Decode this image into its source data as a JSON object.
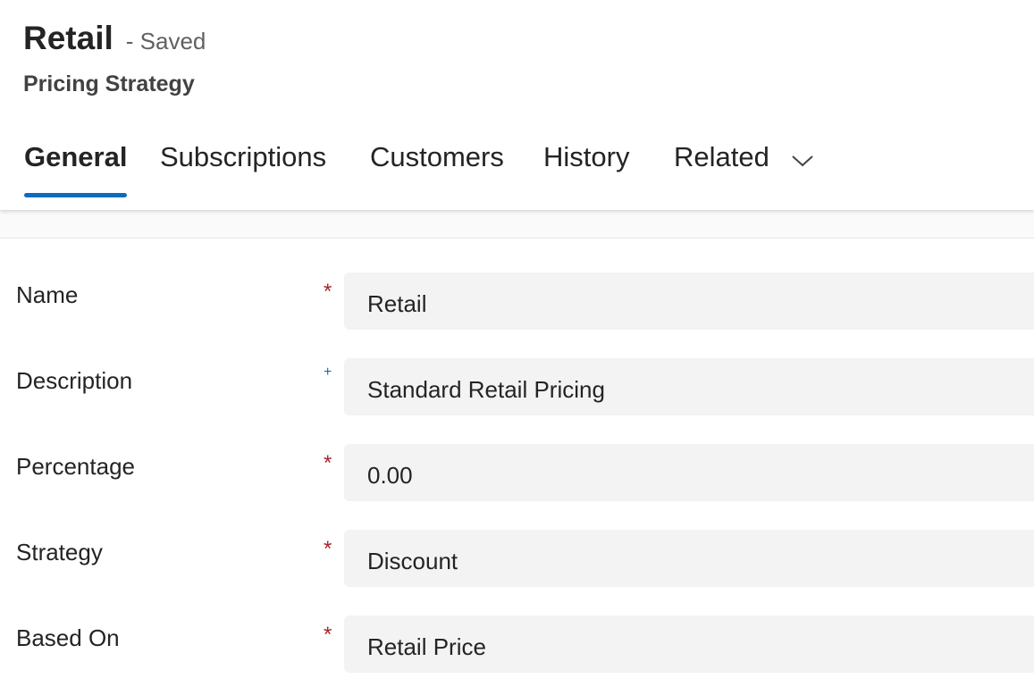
{
  "header": {
    "title": "Retail",
    "status": "- Saved",
    "entity": "Pricing Strategy"
  },
  "tabs": [
    {
      "label": "General",
      "active": true
    },
    {
      "label": "Subscriptions",
      "active": false
    },
    {
      "label": "Customers",
      "active": false
    },
    {
      "label": "History",
      "active": false
    },
    {
      "label": "Related",
      "active": false,
      "icon": "chevron-down-icon"
    }
  ],
  "form": {
    "fields": [
      {
        "label": "Name",
        "indicator": "*",
        "indicator_type": "required",
        "value": "Retail"
      },
      {
        "label": "Description",
        "indicator": "+",
        "indicator_type": "recommended",
        "value": "Standard Retail Pricing"
      },
      {
        "label": "Percentage",
        "indicator": "*",
        "indicator_type": "required",
        "value": "0.00"
      },
      {
        "label": "Strategy",
        "indicator": "*",
        "indicator_type": "required",
        "value": "Discount"
      },
      {
        "label": "Based On",
        "indicator": "*",
        "indicator_type": "required",
        "value": "Retail Price"
      }
    ]
  },
  "colors": {
    "accent": "#0f6cbd",
    "required": "#a4262c",
    "field_background": "#f3f3f3"
  }
}
